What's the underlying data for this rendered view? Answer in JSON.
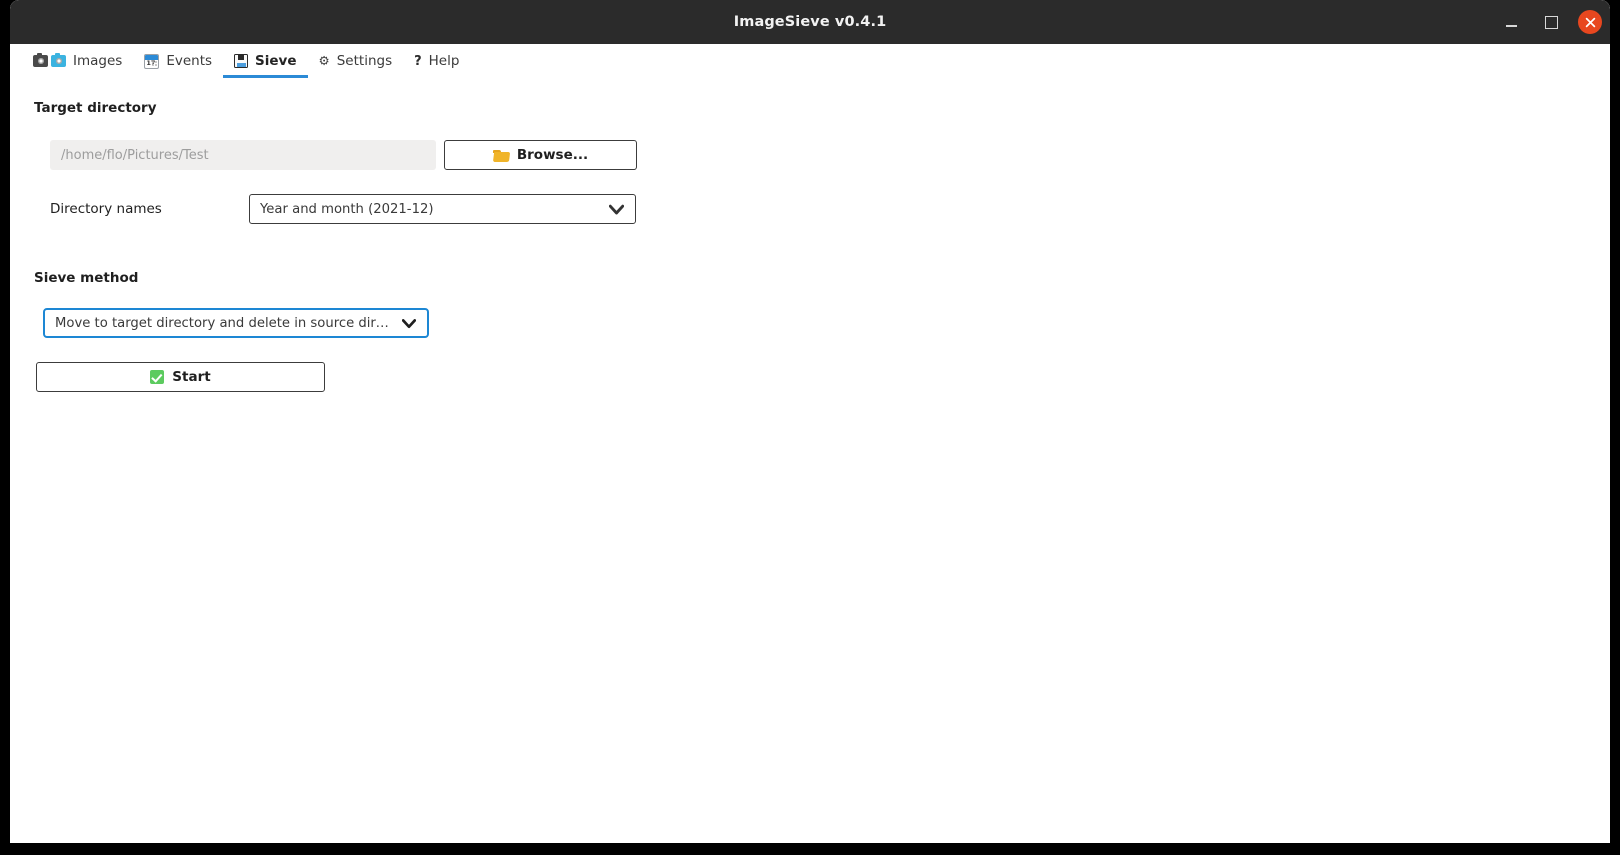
{
  "window": {
    "title": "ImageSieve v0.4.1",
    "controls": {
      "minimize": "minimize",
      "maximize": "maximize",
      "close": "close"
    }
  },
  "tabs": [
    {
      "label": "Images",
      "icons": [
        "camera-icon",
        "camera-blue-icon"
      ],
      "active": false
    },
    {
      "label": "Events",
      "icons": [
        "calendar-icon"
      ],
      "active": false
    },
    {
      "label": "Sieve",
      "icons": [
        "floppy-disk-icon"
      ],
      "active": true
    },
    {
      "label": "Settings",
      "icons": [
        "gear-icon"
      ],
      "active": false
    },
    {
      "label": "Help",
      "icons": [
        "question-mark-icon"
      ],
      "active": false
    }
  ],
  "target_directory": {
    "heading": "Target directory",
    "path_placeholder": "/home/flo/Pictures/Test",
    "path_value": "",
    "browse_label": "Browse...",
    "browse_icon": "open-folder-icon",
    "directory_names_label": "Directory names",
    "directory_names_value": "Year and month (2021-12)"
  },
  "sieve_method": {
    "heading": "Sieve method",
    "value": "Move to target directory and delete in source directory",
    "focused": true
  },
  "start": {
    "label": "Start",
    "icon": "green-check-icon"
  },
  "colors": {
    "titlebar_bg": "#2b2b2b",
    "accent_blue": "#2b8ad6",
    "focus_blue": "#1d87d4",
    "close_red": "#e8471f",
    "input_bg": "#f0efee",
    "check_green": "#5ccb5f",
    "folder_yellow": "#f0b429"
  }
}
